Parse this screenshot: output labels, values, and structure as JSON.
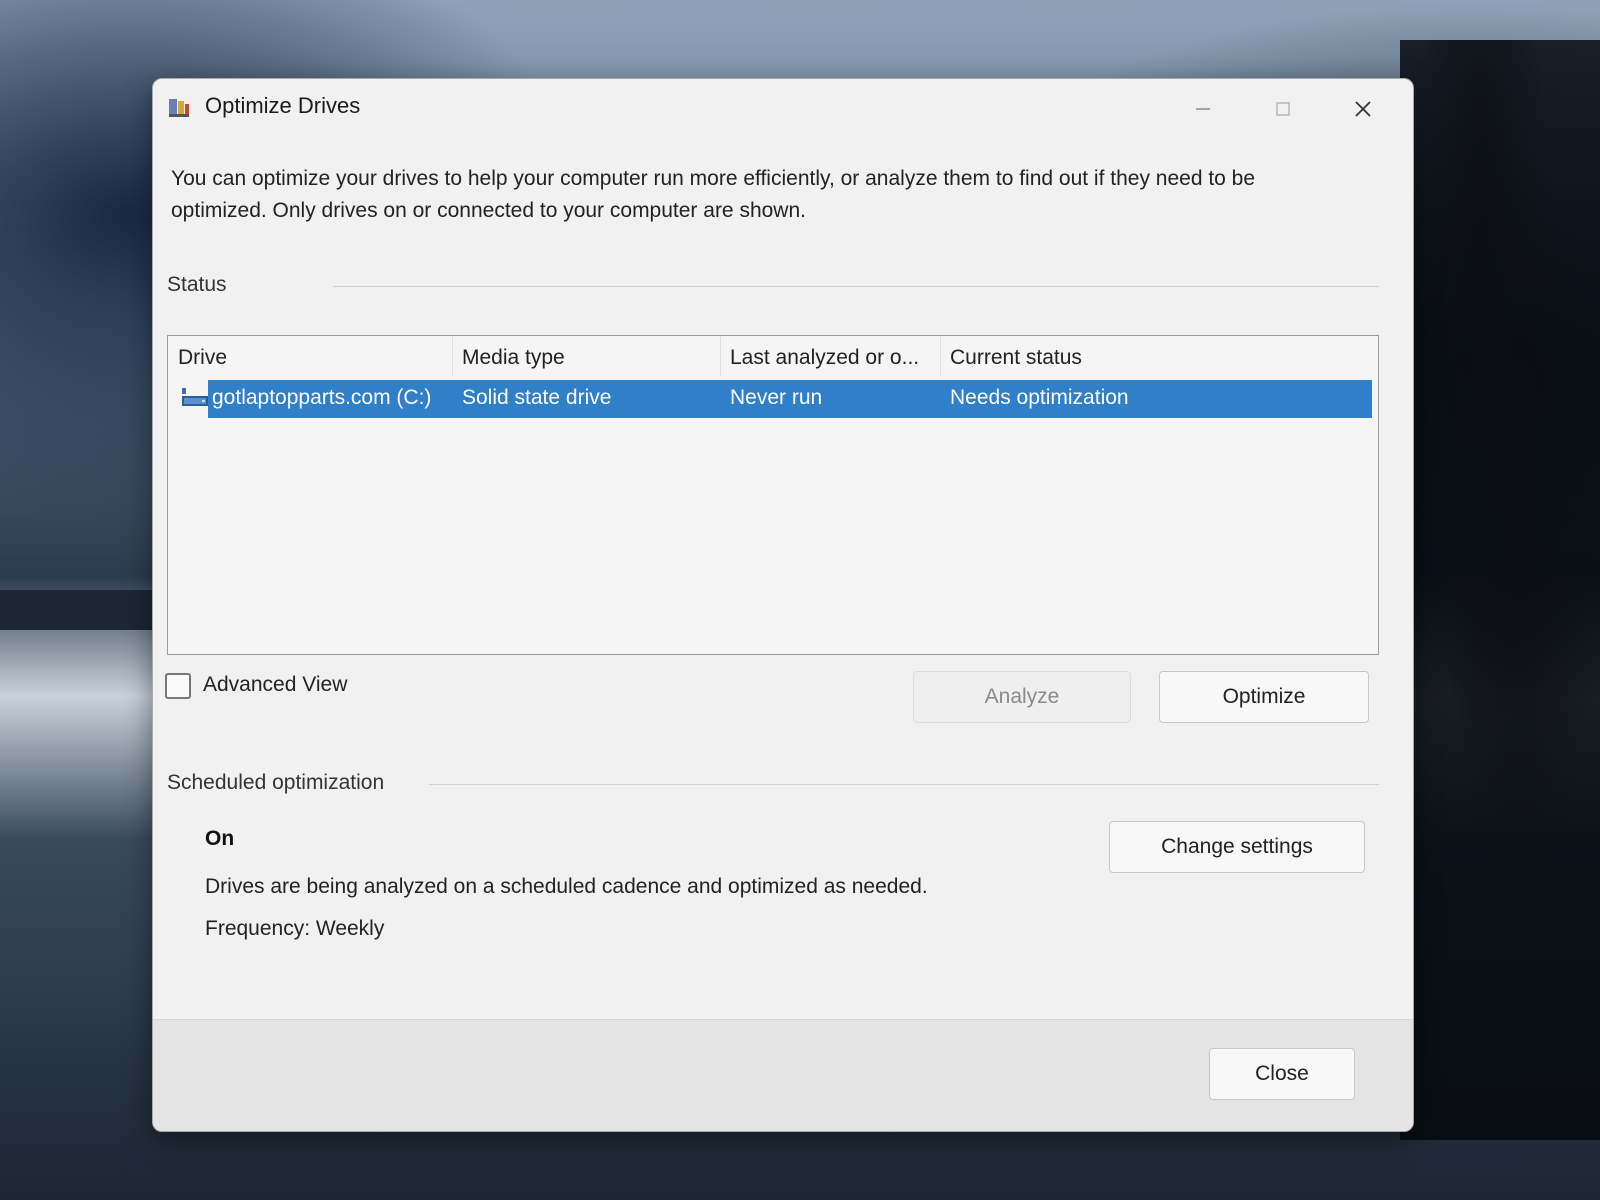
{
  "window": {
    "title": "Optimize Drives",
    "intro_text": "You can optimize your drives to help your computer run more efficiently, or analyze them to find out if they need to be optimized. Only drives on or connected to your computer are shown."
  },
  "status": {
    "label": "Status",
    "columns": [
      "Drive",
      "Media type",
      "Last analyzed or o...",
      "Current status"
    ],
    "rows": [
      {
        "drive": "gotlaptopparts.com (C:)",
        "media_type": "Solid state drive",
        "last_analyzed": "Never run",
        "current_status": "Needs optimization",
        "selected": true
      }
    ]
  },
  "advanced_view": {
    "label": "Advanced View",
    "checked": false
  },
  "buttons": {
    "analyze": "Analyze",
    "optimize": "Optimize",
    "change_settings": "Change settings",
    "close": "Close"
  },
  "scheduled": {
    "label": "Scheduled optimization",
    "state": "On",
    "description": "Drives are being analyzed on a scheduled cadence and optimized as needed.",
    "frequency": "Frequency: Weekly"
  },
  "colors": {
    "selection": "#2f7fc9",
    "window_bg": "#f1f1f1"
  },
  "icons": {
    "app": "defrag-drives-icon",
    "drive": "hard-drive-icon",
    "minimize": "minimize-icon",
    "maximize": "maximize-icon",
    "close": "close-icon"
  }
}
